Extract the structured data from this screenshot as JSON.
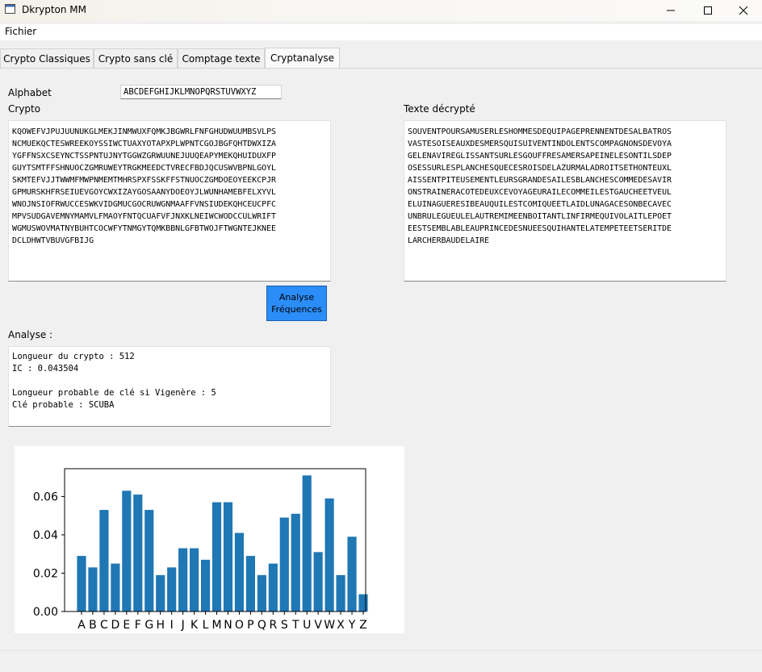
{
  "window": {
    "title": "Dkrypton MM",
    "icons": [
      "app-window-icon",
      "minimize-icon",
      "maximize-icon",
      "close-icon"
    ]
  },
  "menu": {
    "file": "Fichier"
  },
  "tabs": [
    {
      "label": "Crypto Classiques",
      "active": false
    },
    {
      "label": "Crypto sans clé",
      "active": false
    },
    {
      "label": "Comptage texte",
      "active": false
    },
    {
      "label": "Cryptanalyse",
      "active": true
    }
  ],
  "form": {
    "alphabet_label": "Alphabet",
    "alphabet_value": "ABCDEFGHIJKLMNOPQRSTUVWXYZ",
    "crypto_label": "Crypto",
    "decrypted_label": "Texte décrypté",
    "analyse_label": "Analyse :",
    "button_line1": "Analyse",
    "button_line2": "Fréquences",
    "button_color": "#2b8df7"
  },
  "crypto_lines": [
    "KQOWEFVJPUJUUNUKGLMEKJINMWUXFQMKJBGWRLFNFGHUDWUUMBSVLPS",
    "NCMUEKQCTESWREEKOYSSIWCTUAXYOTAPXPLWPNTCGOJBGFQHTDWXIZA",
    "YGFFNSXCSEYNCTSSPNTUJNYTGGWZGRWUUNEJUUQEAPYMEKQHUIDUXFP",
    "GUYTSMTFFSHNUOCZGMRUWEYTRGKMEEDCTVRECFBDJQCUSWVBPNLGOYL",
    "SKMTEFVJJTWWMFMWPNMEMTMHRSPXFSSKFFSTNUOCZGMDOEOYEEKCPJR",
    "GPMURSKHFRSEIUEVGOYCWXIZAYGOSAANYDOEOYJLWUNHAMEBFELXYVL",
    "WNOJNSIOFRWUCCESWKVIDGMUCGOCRUWGNMAAFFVNSIUDEKQHCEUCPFC",
    "MPVSUDGAVEMNYMAMVLFMAOYFNTQCUAFVFJNXKLNEIWCWODCCULWRIFT",
    "WGMUSWOVMATNYBUHTCOCWFYTNMGYTQMKBBNLGFBTWOJFTWGNTEJKNEE",
    "DCLDHWTVBUVGFBIJG"
  ],
  "decrypted_lines": [
    "SOUVENTPOURSAMUSERLESHOMMESDEQUIPAGEPRENNENTDESALBATROS",
    "VASTESOISEAUXDESMERSQUISUIVENTINDOLENTSCOMPAGNONSDEVOYA",
    "GELENAVIREGLISSANTSURLESGOUFFRESAMERSAPEINELESONTILSDEP",
    "OSESSURLESPLANCHESQUECESROISDELAZURMALADROITSETHONTEUXL",
    "AISSENTPITEUSEMENTLEURSGRANDESAILESBLANCHESCOMMEDESAVIR",
    "ONSTRAINERACOTEDEUXCEVOYAGEURAILECOMMEILESTGAUCHEETVEUL",
    "ELUINAGUERESIBEAUQUILESTCOMIQUEETLAIDLUNAGACESONBECAVEC",
    "UNBRULEGUEULELAUTREMIMEENBOITANTLINFIRMEQUIVOLAITLEPOET",
    "EESTSEMBLABLEAUPRINCEDESNUEESQUIHANTELATEMPETEETSERITDE",
    "LARCHERBAUDELAIRE"
  ],
  "analysis_lines": [
    "Longueur du crypto : 512",
    "IC : 0.043504",
    "",
    "Longueur probable de clé si Vigenère : 5",
    "Clé probable : SCUBA"
  ],
  "chart_data": {
    "type": "bar",
    "categories": [
      "A",
      "B",
      "C",
      "D",
      "E",
      "F",
      "G",
      "H",
      "I",
      "J",
      "K",
      "L",
      "M",
      "N",
      "O",
      "P",
      "Q",
      "R",
      "S",
      "T",
      "U",
      "V",
      "W",
      "X",
      "Y",
      "Z"
    ],
    "values": [
      0.029,
      0.023,
      0.053,
      0.025,
      0.063,
      0.061,
      0.053,
      0.019,
      0.023,
      0.033,
      0.033,
      0.027,
      0.057,
      0.057,
      0.041,
      0.029,
      0.019,
      0.025,
      0.049,
      0.051,
      0.071,
      0.031,
      0.059,
      0.019,
      0.039,
      0.009
    ],
    "yticks": [
      "0.00",
      "0.02",
      "0.04",
      "0.06"
    ],
    "ylim": [
      0,
      0.0745
    ],
    "bar_color": "#1f77b4",
    "grid": false
  }
}
